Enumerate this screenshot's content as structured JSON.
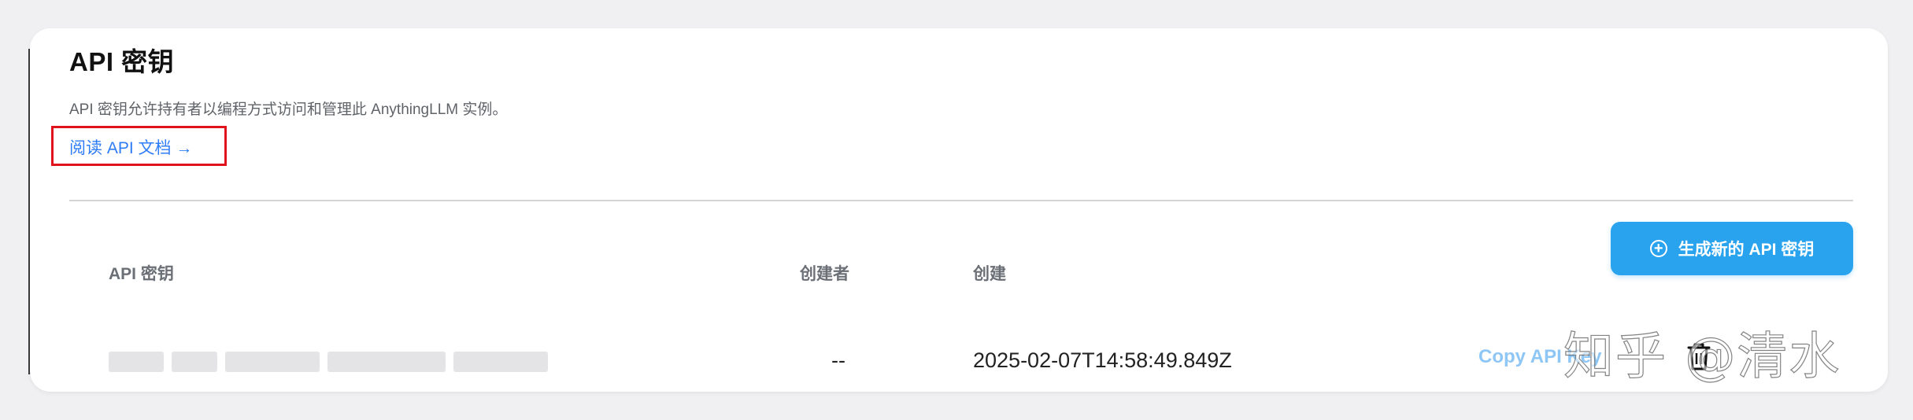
{
  "section": {
    "title": "API 密钥",
    "description": "API 密钥允许持有者以编程方式访问和管理此 AnythingLLM 实例。",
    "docs_link": "阅读 API 文档 →"
  },
  "generate_button": {
    "label": "生成新的 API 密钥",
    "icon": "plus-circle-icon"
  },
  "table": {
    "headers": {
      "api_key": "API 密钥",
      "created_by": "创建者",
      "created": "创建"
    },
    "rows": [
      {
        "created_by": "--",
        "created": "2025-02-07T14:58:49.849Z",
        "copy_label": "Copy API Key",
        "delete_icon": "trash-icon"
      }
    ]
  },
  "watermark": "知乎 @清水",
  "colors": {
    "accent": "#2aa3ef",
    "link": "#2e7cf6",
    "highlight": "#e0121b",
    "copy_link": "#8ec6f5"
  }
}
